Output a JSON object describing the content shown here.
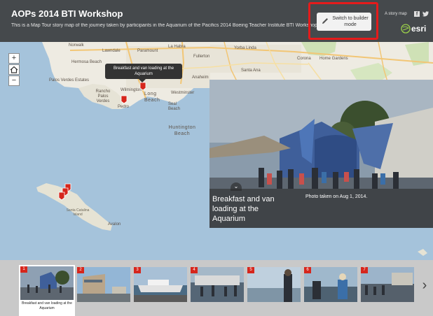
{
  "header": {
    "title": "AOPs 2014 BTI Workshop",
    "subtitle": "This is a Map Tour story map of the journey taken by participants in the Aquarium of the Pacifics 2014 Boeing Teacher Institute BTI Workshop",
    "builder_button_label": "Switch to builder mode",
    "story_map_label": "A story map",
    "facebook_icon": "f",
    "esri_logo": "esri"
  },
  "map_controls": {
    "zoom_in": "+",
    "home": "⌂",
    "zoom_out": "−"
  },
  "places": {
    "norwalk": "Norwalk",
    "la_habra": "La Habra",
    "yorba_linda": "Yorba Linda",
    "lawndale": "Lawndale",
    "paramount": "Paramount",
    "fullerton": "Fullerton",
    "corona": "Corona",
    "home_gardens": "Home Gardens",
    "hermosa_beach": "Hermosa Beach",
    "palos_verdes_estates": "Palos Verdes Estates",
    "anaheim": "Anaheim",
    "santa_ana": "Santa Ana",
    "rancho_palos_verdes": "Rancho Palos Verdes",
    "wilmington": "Wilmington",
    "long_beach": "Long Beach",
    "westminster": "Westminster",
    "seal_beach": "Seal Beach",
    "pedro": "Pedro",
    "huntington_beach": "Huntington Beach",
    "santa_catalina_island": "Santa Catalina Island",
    "avalon": "Avalon"
  },
  "tooltip": {
    "text": "Breakfast and van loading at the Aquarium"
  },
  "photo_panel": {
    "title": "Breakfast and van loading at the Aquarium",
    "caption": "Photo taken on Aug 1, 2014.",
    "collapse_icon": "⌄"
  },
  "carousel": {
    "items": [
      {
        "num": "1",
        "label": "Breakfast and van loading at the Aquarium"
      },
      {
        "num": "2"
      },
      {
        "num": "3"
      },
      {
        "num": "4"
      },
      {
        "num": "5"
      },
      {
        "num": "6"
      },
      {
        "num": "7"
      }
    ],
    "next_icon": "›"
  },
  "colors": {
    "header_bg": "#45494c",
    "accent_red": "#d6261c",
    "highlight_outline": "#e51b1b",
    "water": "#a5c3db",
    "land": "#eeebe2"
  }
}
